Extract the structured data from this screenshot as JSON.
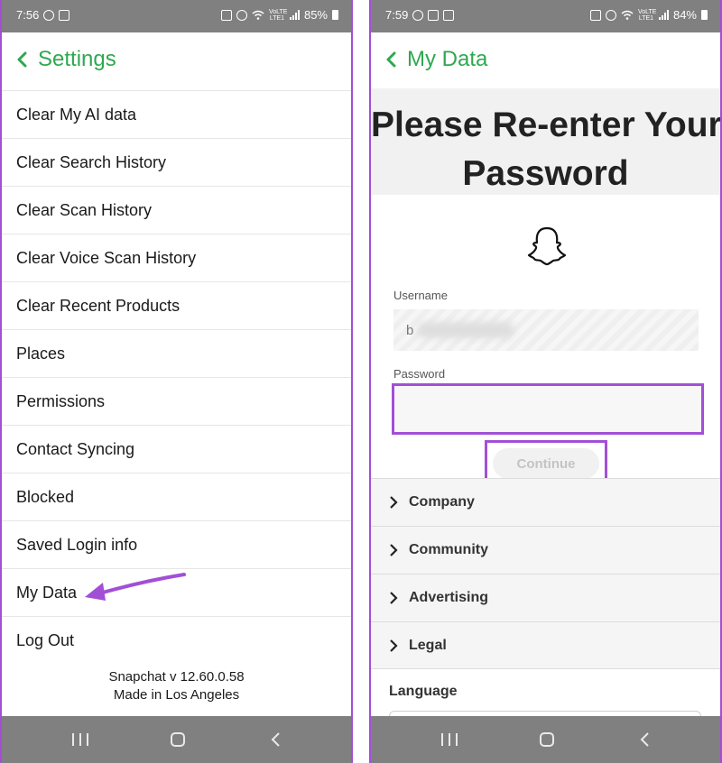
{
  "colors": {
    "accent_green": "#2fa84f",
    "highlight_purple": "#a24fd6",
    "system_bar_gray": "#808080"
  },
  "left": {
    "status": {
      "time": "7:56",
      "battery": "85%",
      "network": "VoLTE LTE1",
      "icons": [
        "whatsapp-icon",
        "gmail-icon",
        "battery-saver-icon",
        "alarm-icon",
        "wifi-icon",
        "signal-icon",
        "battery-icon"
      ]
    },
    "header": {
      "back_icon": "chevron-left-icon",
      "title": "Settings"
    },
    "items": [
      {
        "label": "Clear My AI data"
      },
      {
        "label": "Clear Search History"
      },
      {
        "label": "Clear Scan History"
      },
      {
        "label": "Clear Voice Scan History"
      },
      {
        "label": "Clear Recent Products"
      },
      {
        "label": "Places"
      },
      {
        "label": "Permissions"
      },
      {
        "label": "Contact Syncing"
      },
      {
        "label": "Blocked"
      },
      {
        "label": "Saved Login info"
      },
      {
        "label": "My Data"
      },
      {
        "label": "Log Out"
      }
    ],
    "footer": {
      "version": "Snapchat v 12.60.0.58",
      "made_in": "Made in Los Angeles"
    },
    "annotation": "arrow-pointer-icon"
  },
  "right": {
    "status": {
      "time": "7:59",
      "battery": "84%",
      "network": "VoLTE LTE1",
      "icons": [
        "whatsapp-icon",
        "gmail-icon",
        "gallery-icon",
        "battery-saver-icon",
        "alarm-icon",
        "wifi-icon",
        "signal-icon",
        "battery-icon"
      ]
    },
    "header": {
      "back_icon": "chevron-left-icon",
      "title": "My Data"
    },
    "heading_line1": "Please Re-enter Your",
    "heading_line2": "Password",
    "logo_icon": "snapchat-ghost-icon",
    "username": {
      "label": "Username",
      "value": "b"
    },
    "password": {
      "label": "Password",
      "value": ""
    },
    "continue_label": "Continue",
    "accordion": [
      {
        "label": "Company"
      },
      {
        "label": "Community"
      },
      {
        "label": "Advertising"
      },
      {
        "label": "Legal"
      }
    ],
    "language_label": "Language"
  },
  "navbar": {
    "icons": [
      "recents-icon",
      "home-icon",
      "back-icon"
    ]
  }
}
